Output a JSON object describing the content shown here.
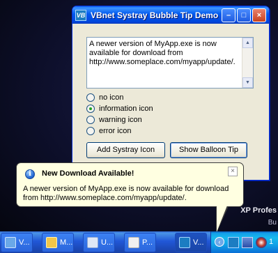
{
  "window": {
    "title": "VBnet Systray Bubble Tip Demo",
    "icon_text": "VB",
    "minimize_glyph": "–",
    "maximize_glyph": "□",
    "close_glyph": "×"
  },
  "textbox": {
    "value": "A newer version of MyApp.exe is now available for download from http://www.someplace.com/myapp/update/."
  },
  "options": [
    {
      "label": "no icon",
      "checked": false
    },
    {
      "label": "information icon",
      "checked": true
    },
    {
      "label": "warning icon",
      "checked": false
    },
    {
      "label": "error icon",
      "checked": false
    }
  ],
  "buttons": {
    "add_systray": "Add Systray Icon",
    "show_balloon": "Show Balloon Tip"
  },
  "balloon": {
    "title": "New Download Available!",
    "icon_glyph": "i",
    "close_glyph": "×",
    "body": "A newer version of MyApp.exe is now available for download from http://www.someplace.com/myapp/update/."
  },
  "desktop": {
    "watermark": "XP Profes",
    "sub": "Bu"
  },
  "taskbar": {
    "tasks": [
      {
        "label": "V...",
        "icon": "window-icon",
        "color": "#6aa8e8"
      },
      {
        "label": "M...",
        "icon": "help-icon",
        "color": "#f2c64a"
      },
      {
        "label": "U...",
        "icon": "document-icon",
        "color": "#dfe7f5"
      },
      {
        "label": "P...",
        "icon": "paint-icon",
        "color": "#f0f0f0"
      },
      {
        "label": "V...",
        "icon": "vb-icon",
        "color": "#1c7dc2"
      }
    ],
    "tray_chevron": "‹",
    "clock": "1"
  }
}
